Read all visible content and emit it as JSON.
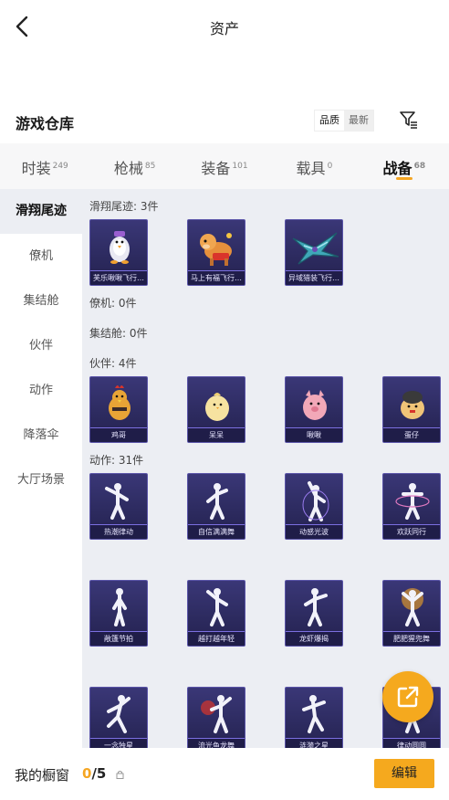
{
  "header": {
    "title": "资产"
  },
  "section": {
    "title": "游戏仓库",
    "sort": {
      "quality": "品质",
      "newest": "最新"
    }
  },
  "tabs": [
    {
      "label": "时装",
      "count": "249"
    },
    {
      "label": "枪械",
      "count": "85"
    },
    {
      "label": "装备",
      "count": "101"
    },
    {
      "label": "载具",
      "count": "0"
    },
    {
      "label": "战备",
      "count": "68"
    }
  ],
  "sidebar": {
    "items": [
      "滑翔尾迹",
      "僚机",
      "集结舱",
      "伙伴",
      "动作",
      "降落伞",
      "大厅场景"
    ]
  },
  "groups": {
    "glide": {
      "label": "滑翔尾迹: 3件",
      "items": [
        "芙乐啾啾飞行…",
        "马上有福飞行…",
        "异域猎装飞行…"
      ]
    },
    "wingman": {
      "label": "僚机: 0件"
    },
    "rally": {
      "label": "集结舱: 0件"
    },
    "partner": {
      "label": "伙伴: 4件",
      "items": [
        "鸡哥",
        "呆呆",
        "啾啾",
        "蛋仔"
      ]
    },
    "emote": {
      "label": "动作: 31件",
      "items": [
        "热潮律动",
        "自信满满舞",
        "动感光波",
        "欢跃同行",
        "敞篷节拍",
        "越打越年轻",
        "龙虾爆揭",
        "肥肥猩兜舞",
        "一念独星",
        "流光鱼龙舞",
        "涟漪之星",
        "律动圆圆"
      ]
    }
  },
  "bottom": {
    "label": "我的橱窗",
    "current": "0",
    "total": "/5",
    "edit": "编辑"
  },
  "colors": {
    "accent": "#f5a623",
    "card_bg": "#2c2a5e"
  }
}
